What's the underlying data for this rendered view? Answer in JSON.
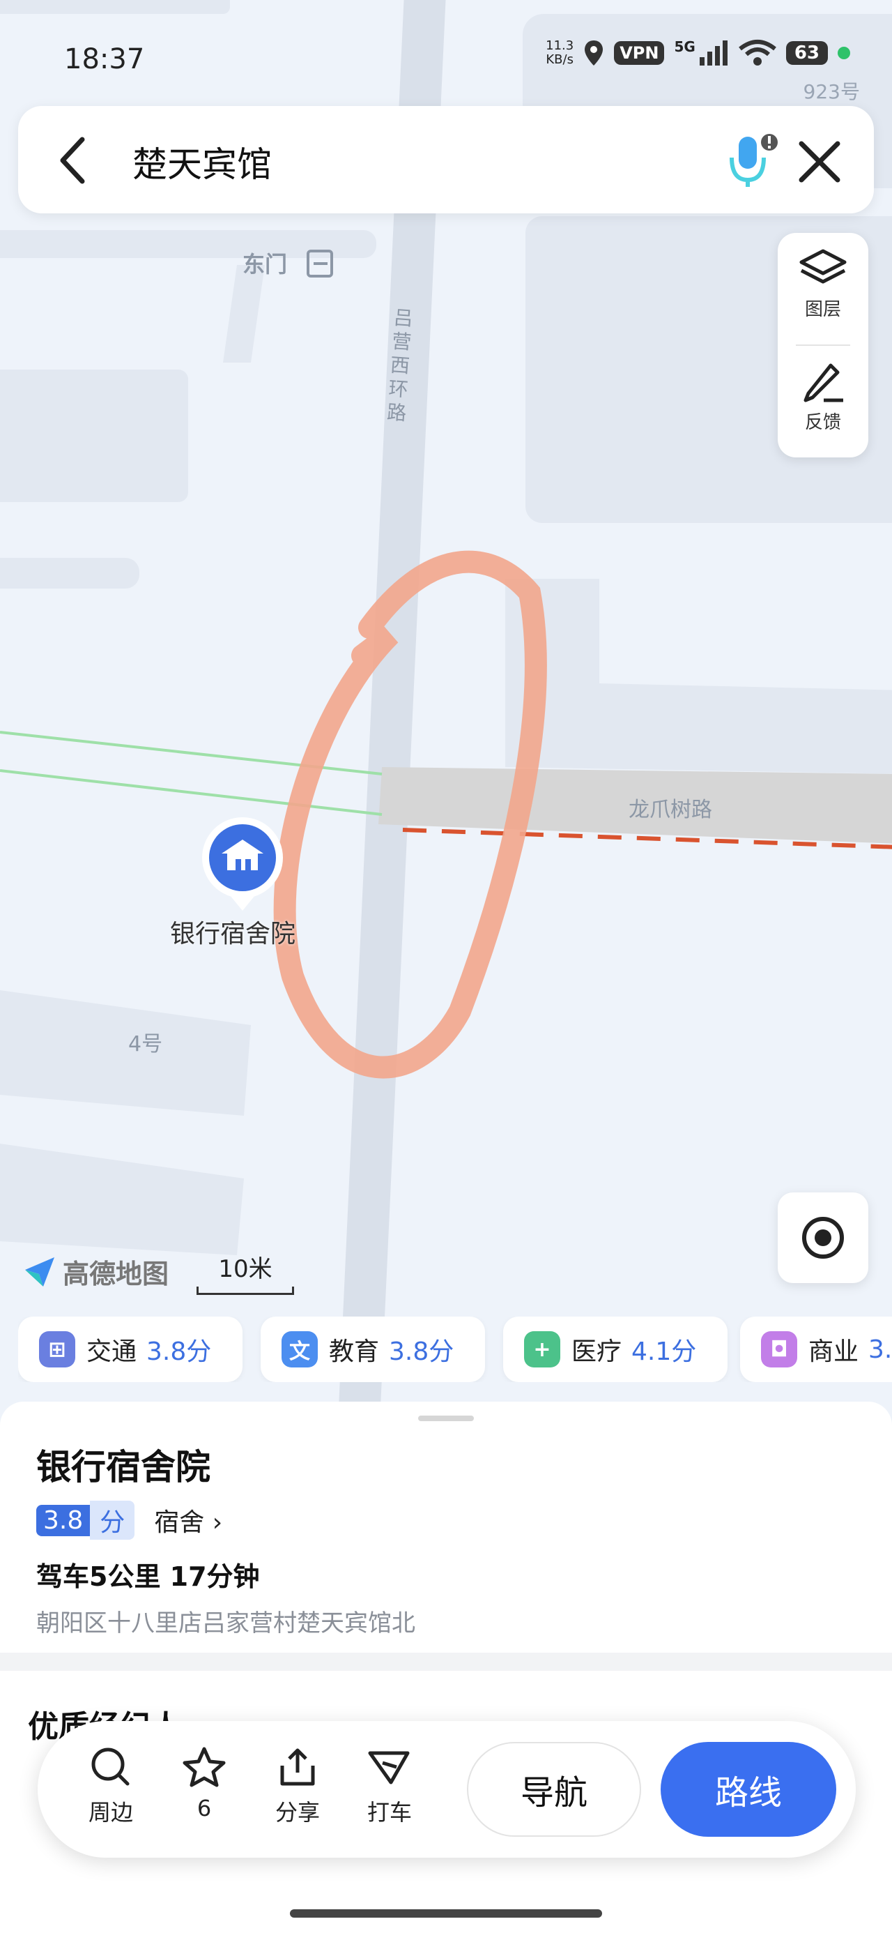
{
  "status": {
    "time": "18:37",
    "net_speed_value": "11.3",
    "net_speed_unit": "KB/s",
    "vpn": "VPN",
    "signal": "5G",
    "battery": "63",
    "door_number": "923号"
  },
  "search": {
    "query": "楚天宾馆",
    "back_icon": "chevron-left-icon",
    "mic_icon": "microphone-icon",
    "close_icon": "close-icon"
  },
  "map_panel": {
    "layers_label": "图层",
    "feedback_label": "反馈"
  },
  "map": {
    "east_gate": "东门",
    "road_vertical": "吕营西环路",
    "road_horizontal": "龙爪树路",
    "poi_name": "银行宿舍院",
    "building_4": "4号",
    "logo": "高德地图",
    "scale": "10米",
    "annotation_color": "#f2a68c"
  },
  "chips": [
    {
      "label": "交通",
      "score": "3.8分",
      "color": "#6a7fe0",
      "icon": "train-icon"
    },
    {
      "label": "教育",
      "score": "3.8分",
      "color": "#4c8ef0",
      "icon": "education-icon"
    },
    {
      "label": "医疗",
      "score": "4.1分",
      "color": "#4cc28a",
      "icon": "medical-icon"
    },
    {
      "label": "商业",
      "score": "3.",
      "color": "#c27ee8",
      "icon": "shopping-bag-icon"
    }
  ],
  "place": {
    "title": "银行宿舍院",
    "score": "3.8",
    "score_unit": "分",
    "category": "宿舍",
    "drive": "驾车5公里 17分钟",
    "address": "朝阳区十八里店吕家营村楚天宾馆北",
    "section": "优质经纪人"
  },
  "actions": {
    "nearby": "周边",
    "favorites": "6",
    "share": "分享",
    "taxi": "打车",
    "navigate": "导航",
    "route": "路线"
  }
}
